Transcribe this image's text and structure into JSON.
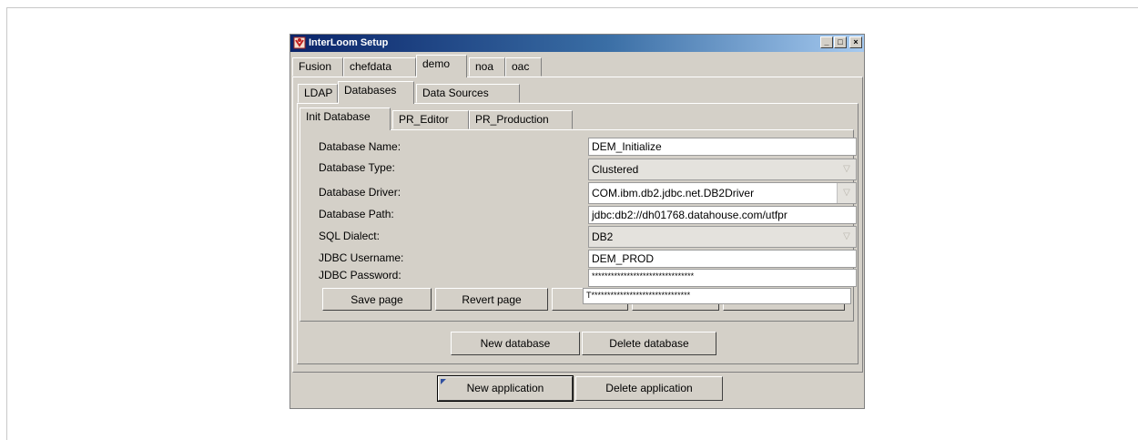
{
  "window": {
    "title": "InterLoom Setup",
    "minimize": "_",
    "maximize": "□",
    "close": "×"
  },
  "app_tabs": [
    "Fusion",
    "chefdata",
    "demo",
    "noa",
    "oac"
  ],
  "app_tabs_active": "demo",
  "section_tabs": [
    "LDAP",
    "Databases",
    "Data Sources"
  ],
  "section_tabs_active": "Databases",
  "db_tabs": [
    "Init Database",
    "PR_Editor",
    "PR_Production"
  ],
  "db_tabs_active": "Init Database",
  "form": {
    "name_label": "Database Name:",
    "name_value": "DEM_Initialize",
    "type_label": "Database Type:",
    "type_value": "Clustered",
    "driver_label": "Database Driver:",
    "driver_value": "COM.ibm.db2.jdbc.net.DB2Driver",
    "path_label": "Database Path:",
    "path_value": "jdbc:db2://dh01768.datahouse.com/utfpr",
    "dialect_label": "SQL Dialect:",
    "dialect_value": "DB2",
    "user_label": "JDBC Username:",
    "user_value": "DEM_PROD",
    "pass_label": "JDBC Password:",
    "pass_value": "********************************",
    "pass_confirm_value": "T*******************************"
  },
  "page_buttons": {
    "save": "Save page",
    "revert": "Revert page"
  },
  "db_buttons": {
    "new": "New database",
    "delete": "Delete database"
  },
  "app_buttons": {
    "new": "New application",
    "delete": "Delete application"
  }
}
